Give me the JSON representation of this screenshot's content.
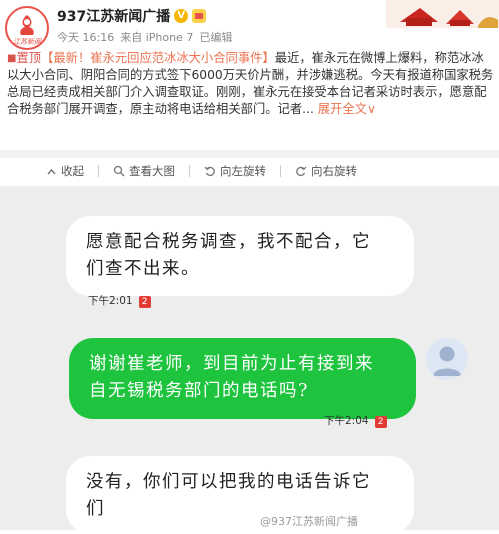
{
  "header": {
    "account_name": "937江苏新闻广播",
    "logo_text": "江苏新闻",
    "meta": {
      "time": "今天 16:16",
      "source": "来自 iPhone 7",
      "edited": "已编辑"
    }
  },
  "post": {
    "tag": "置顶",
    "topic": "【最新！崔永元回应范冰冰大小合同事件】",
    "body": "最近，崔永元在微博上爆料，称范冰冰以大小合同、阴阳合同的方式签下6000万天价片酬，并涉嫌逃税。今天有报道称国家税务总局已经责成相关部门介入调查取证。刚刚，崔永元在接受本台记者采访时表示，愿意配合税务部门展开调查，原主动将电话给相关部门。记者",
    "ellipsis": "...",
    "expand_label": "展开全文",
    "expand_arrow": "∨"
  },
  "toolbar": {
    "collapse": "收起",
    "view_large": "查看大图",
    "rotate_left": "向左旋转",
    "rotate_right": "向右旋转"
  },
  "chat": {
    "messages": [
      {
        "side": "left",
        "text": "愿意配合税务调查，我不配合，它们查不出来。",
        "line1": "愿意配合税务调查，我不配合，它",
        "line2": "们查不出来。",
        "time": "下午2:01",
        "badge": "2"
      },
      {
        "side": "right",
        "text": "谢谢崔老师，到目前为止有接到来自无锡税务部门的电话吗?",
        "line1": "谢谢崔老师，到目前为止有接到来",
        "line2": "自无锡税务部门的电话吗?",
        "time": "下午2:04",
        "badge": "2"
      },
      {
        "side": "left",
        "text": "没有，你们可以把我的电话告诉它们",
        "line1": "没有，你们可以把我的电话告诉它",
        "line2": "们"
      }
    ],
    "watermark": "@937江苏新闻广播"
  },
  "colors": {
    "accent": "#eb7350",
    "bubble_green": "#1ec33e",
    "chat_bg": "#ededed",
    "badge_red": "#e23b33"
  }
}
